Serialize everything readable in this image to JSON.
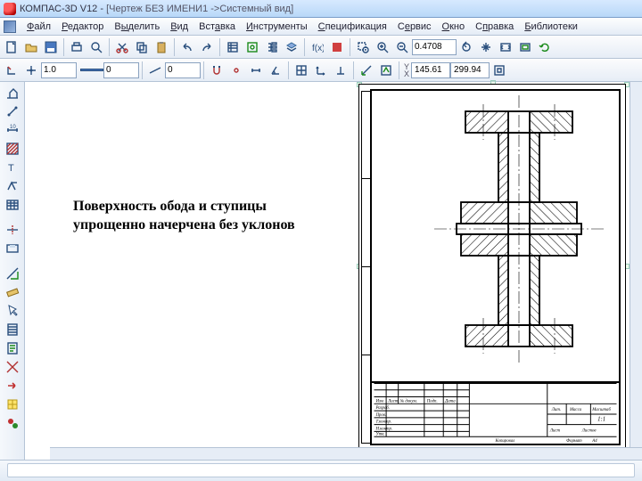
{
  "app": {
    "name": "КОМПАС-3D V12",
    "doc": "[Чертеж БЕЗ ИМЕНИ1 ->Системный вид]"
  },
  "menus": {
    "file": "Файл",
    "edit": "Редактор",
    "select": "Выделить",
    "view": "Вид",
    "insert": "Вставка",
    "tools": "Инструменты",
    "spec": "Спецификация",
    "service": "Сервис",
    "window": "Окно",
    "help": "Справка",
    "libs": "Библиотеки"
  },
  "props": {
    "lineWeight": "1.0",
    "layer": "0",
    "style": "0"
  },
  "view": {
    "zoom": "0.4708",
    "x": "145.61",
    "y": "299.94"
  },
  "caption": {
    "line1": "Поверхность обода и ступицы",
    "line2": "упрощенно начерчена без уклонов"
  },
  "titleblock": {
    "cols": [
      "Изм",
      "Лист",
      "№ докум.",
      "Подп.",
      "Дата"
    ],
    "rows": [
      "Разраб.",
      "Пров.",
      "Т.контр.",
      "Н.контр.",
      "Утв."
    ],
    "lit": "Лит.",
    "mass": "Масса",
    "scale": "Масштаб",
    "scaleVal": "1:1",
    "sheet": "Лист",
    "sheets": "Листов",
    "copied": "Копировал",
    "format": "Формат",
    "formatVal": "А4"
  }
}
